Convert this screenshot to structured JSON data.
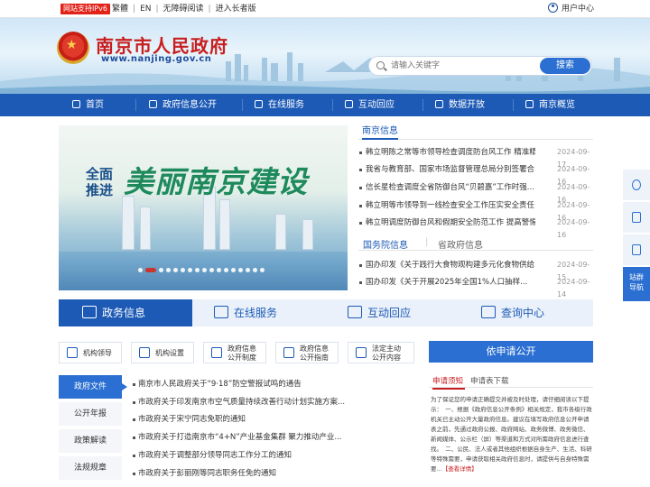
{
  "topbar": {
    "ipv6": "网站支持IPv6",
    "links": [
      "繁體",
      "EN",
      "无障碍阅读",
      "进入长者版"
    ],
    "user_center": "用户中心"
  },
  "header": {
    "title": "南京市人民政府",
    "url": "www.nanjing.gov.cn",
    "search_placeholder": "请输入关键字",
    "search_button": "搜索"
  },
  "nav": [
    "首页",
    "政府信息公开",
    "在线服务",
    "互动回应",
    "数据开放",
    "南京概览"
  ],
  "slider": {
    "line1": "全面",
    "line2": "推进",
    "slogan": "美丽南京建设"
  },
  "news": {
    "tab": "南京信息",
    "items": [
      {
        "title": "韩立明陈之常等市领导检查调度防台风工作 精准精...",
        "date": "2024-09-17"
      },
      {
        "title": "我省与教育部、国家市场监督管理总局分别签署合...",
        "date": "2024-09-16"
      },
      {
        "title": "信长星检查调度全省防御台风“贝碧嘉”工作时强...",
        "date": "2024-09-16"
      },
      {
        "title": "韩立明等市领导到一线检查安全工作压实安全责任 ...",
        "date": "2024-09-16"
      },
      {
        "title": "韩立明调度防御台风和假期安全防范工作 提高警惕...",
        "date": "2024-09-16"
      }
    ],
    "tab2_active": "国务院信息",
    "tab2_other": "省政府信息",
    "items2": [
      {
        "title": "国办印发《关于践行大食物观构建多元化食物供给...",
        "date": "2024-09-15"
      },
      {
        "title": "国办印发《关于开展2025年全国1%人口抽样...",
        "date": "2024-09-14"
      }
    ]
  },
  "bigtabs": [
    "政务信息",
    "在线服务",
    "互动回应",
    "查询中心"
  ],
  "subbuttons": [
    {
      "label": "机构领导"
    },
    {
      "label": "机构设置"
    },
    {
      "label1": "政府信息",
      "label2": "公开制度"
    },
    {
      "label1": "政府信息",
      "label2": "公开指南"
    },
    {
      "label1": "法定主动",
      "label2": "公开内容"
    }
  ],
  "lefttabs": [
    "政府文件",
    "公开年报",
    "政策解读",
    "法规规章"
  ],
  "files": [
    "南京市人民政府关于“9·18”防空警报试鸣的通告",
    "市政府关于印发南京市空气质量持续改善行动计划实施方案...",
    "市政府关于宋宁同志免职的通知",
    "市政府关于打造南京市“4+N”产业基金集群 聚力推动产业...",
    "市政府关于调整部分领导同志工作分工的通知",
    "市政府关于彭丽刚等同志职务任免的通知"
  ],
  "apply": {
    "title": "依申请公开",
    "tab1": "申请须知",
    "tab2": "申请表下载",
    "text": "为了保证您的申请正确提交并被及时处理，请仔细阅读以下提示：　一、根据《政府信息公开条例》相关规定，我市各级行政机关已主动公开大量政府信息。建议在填写政府信息公开申请表之前，先通过政府公报、政府网站、政务微博、政务微信、新闻媒体、公示栏（屏）等渠道和方式对所需政府信息进行查找。　二、公民、法人或者其他组织根据自身生产、生活、科研等特殊需要，申请获取相关政府信息时，请提供与自身特殊需要...",
    "more": "【查看详情】"
  },
  "rightbar": {
    "station_nav": "站群导航"
  }
}
